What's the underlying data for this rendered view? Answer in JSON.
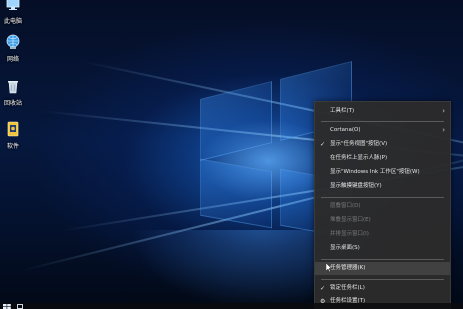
{
  "desktop": {
    "icons": [
      {
        "label": "此电脑",
        "icon": "this-pc-icon"
      },
      {
        "label": "网络",
        "icon": "network-icon"
      },
      {
        "label": "回收站",
        "icon": "recycle-bin-icon"
      },
      {
        "label": "软件",
        "icon": "software-icon"
      }
    ]
  },
  "menu": {
    "items": [
      {
        "label": "工具栏(T)",
        "state": "normal",
        "submenu": true
      },
      {
        "label": "Cortana(O)",
        "state": "normal",
        "submenu": true
      },
      {
        "label": "显示\"任务视图\"按钮(V)",
        "state": "normal",
        "checked": true
      },
      {
        "label": "在任务栏上显示人脉(P)",
        "state": "normal"
      },
      {
        "label": "显示\"Windows Ink 工作区\"按钮(W)",
        "state": "normal"
      },
      {
        "label": "显示触摸键盘按钮(Y)",
        "state": "normal"
      },
      {
        "label": "层叠窗口(D)",
        "state": "disabled"
      },
      {
        "label": "堆叠显示窗口(E)",
        "state": "disabled"
      },
      {
        "label": "并排显示窗口(I)",
        "state": "disabled"
      },
      {
        "label": "显示桌面(S)",
        "state": "normal"
      },
      {
        "label": "任务管理器(K)",
        "state": "hover"
      },
      {
        "label": "锁定任务栏(L)",
        "state": "normal",
        "checked": true
      },
      {
        "label": "任务栏设置(T)",
        "state": "normal",
        "icon": "gear-icon"
      }
    ],
    "check_glyph": "✓",
    "arrow_glyph": "›",
    "gear_glyph": "⚙"
  },
  "colors": {
    "menu_bg": "#2b2b2b",
    "menu_text": "#e8e8e8",
    "menu_disabled": "#7b7b7b",
    "menu_hover": "#414141",
    "wallpaper_accent": "#3c96ff"
  }
}
